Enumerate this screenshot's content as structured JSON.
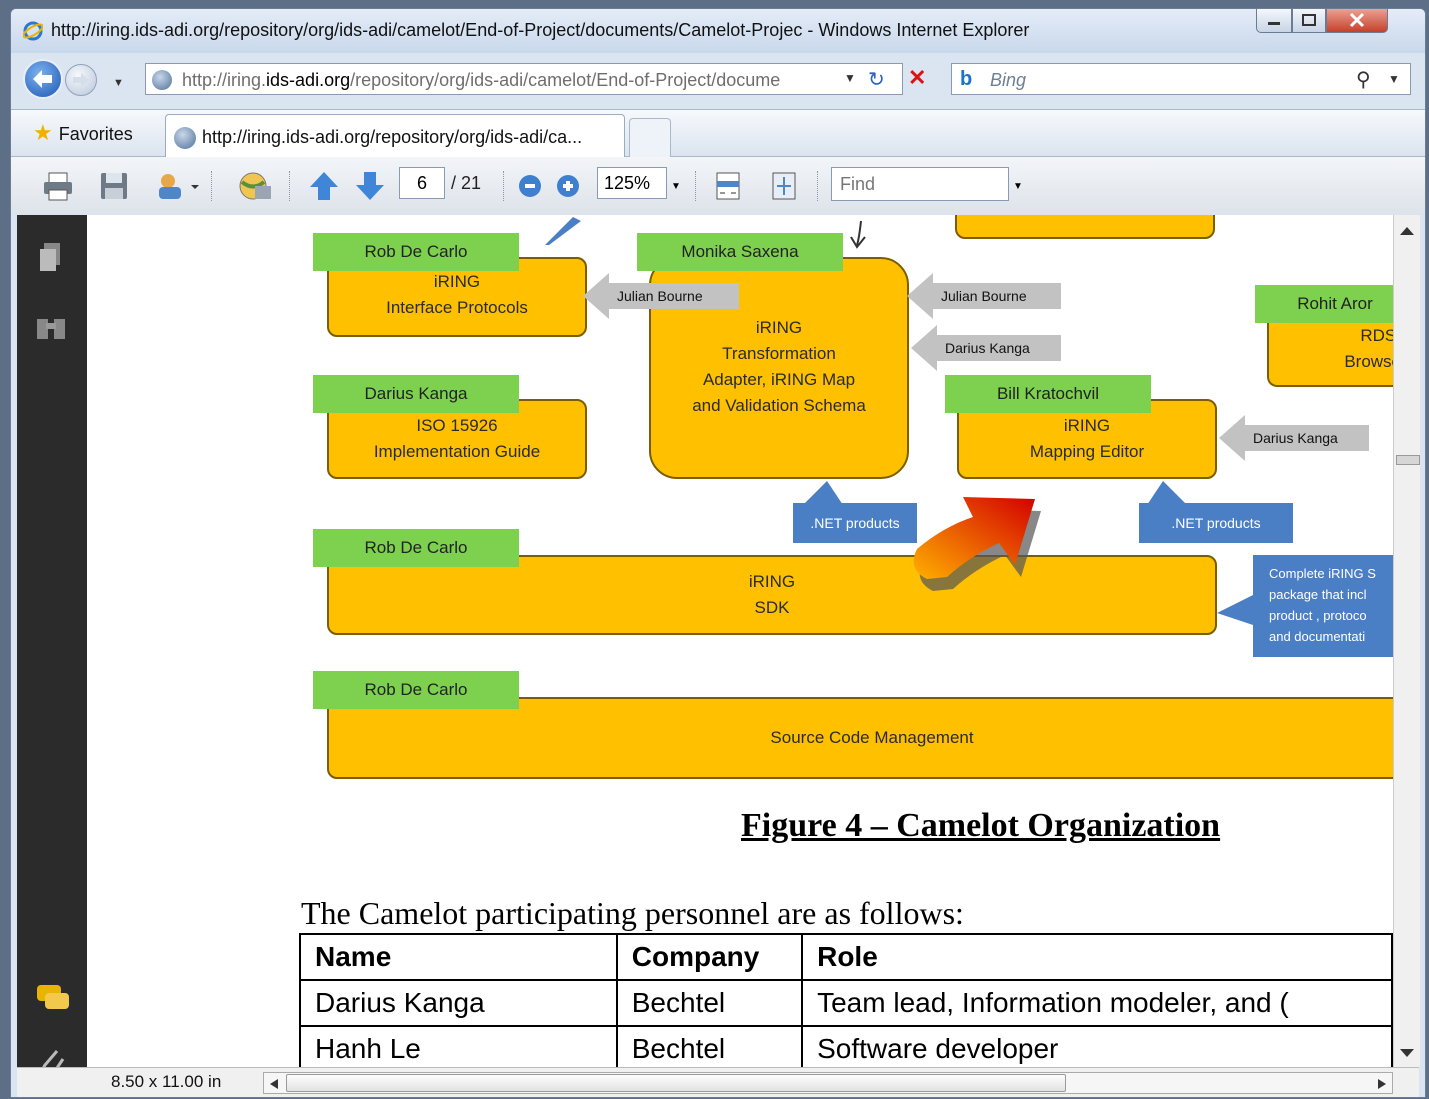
{
  "window": {
    "title": "http://iring.ids-adi.org/repository/org/ids-adi/camelot/End-of-Project/documents/Camelot-Projec - Windows Internet Explorer"
  },
  "address_bar": {
    "url_prefix": "http://iring.",
    "url_domain": "ids-adi.org",
    "url_rest": "/repository/org/ids-adi/camelot/End-of-Project/docume"
  },
  "search": {
    "placeholder": "Bing"
  },
  "favorites": {
    "label": "Favorites"
  },
  "tab": {
    "title": "http://iring.ids-adi.org/repository/org/ids-adi/ca..."
  },
  "pdf_toolbar": {
    "page_current": "6",
    "page_total": "/ 21",
    "zoom": "125%",
    "find_placeholder": "Find"
  },
  "diagram": {
    "owners": {
      "o1": "Rob De Carlo",
      "o2": "Monika Saxena",
      "o3": "Rohit Aror",
      "o4": "Darius Kanga",
      "o5": "Bill Kratochvil",
      "o6": "Rob De Carlo",
      "o7": "Rob De Carlo"
    },
    "boxes": {
      "b1l1": "iRING",
      "b1l2": "Interface Protocols",
      "b2l1": "iRING",
      "b2l2": "Transformation",
      "b2l3": "Adapter, iRING  Map",
      "b2l4": "and Validation  Schema",
      "b3l1": "RDS/",
      "b3l2": "Browse",
      "b4l1": "ISO 15926",
      "b4l2": "Implementation Guide",
      "b5l1": "iRING",
      "b5l2": "Mapping Editor",
      "b6l1": "iRING",
      "b6l2": "SDK",
      "b7l1": "Source Code Management"
    },
    "contributors": {
      "c1": "Julian Bourne",
      "c2": "Julian Bourne",
      "c3": "Darius Kanga",
      "c4": "Darius Kanga"
    },
    "notes": {
      "n1": ".NET products",
      "n2": ".NET products",
      "n3l1": "Complete iRING S",
      "n3l2": "package that incl",
      "n3l3": "product , protoco",
      "n3l4": "and documentati"
    }
  },
  "document": {
    "figure_caption": "Figure 4 – Camelot Organization",
    "paragraph": "The Camelot participating personnel are as follows:",
    "table": {
      "headers": [
        "Name",
        "Company",
        "Role"
      ],
      "rows": [
        [
          "Darius Kanga",
          "Bechtel",
          "Team lead, Information modeler, and ("
        ],
        [
          "Hanh Le",
          "Bechtel",
          "Software developer"
        ]
      ]
    }
  },
  "status": {
    "page_size": "8.50 x 11.00 in"
  },
  "colors": {
    "owner_green": "#7ed14f",
    "deliverable_yellow": "#ffc000",
    "contributor_gray": "#c2c2c2",
    "note_blue": "#4a7fc6"
  },
  "icons": [
    "ie-icon",
    "back-icon",
    "forward-icon",
    "globe-icon",
    "refresh-icon",
    "stop-icon",
    "bing-icon",
    "search-icon",
    "favorites-star-icon",
    "print-icon",
    "save-icon",
    "share-icon",
    "globe-tools-icon",
    "prev-page-icon",
    "next-page-icon",
    "zoom-out-icon",
    "zoom-in-icon",
    "fit-width-icon",
    "fit-page-icon",
    "pages-icon",
    "bookmarks-icon",
    "comments-icon",
    "attachment-icon"
  ]
}
